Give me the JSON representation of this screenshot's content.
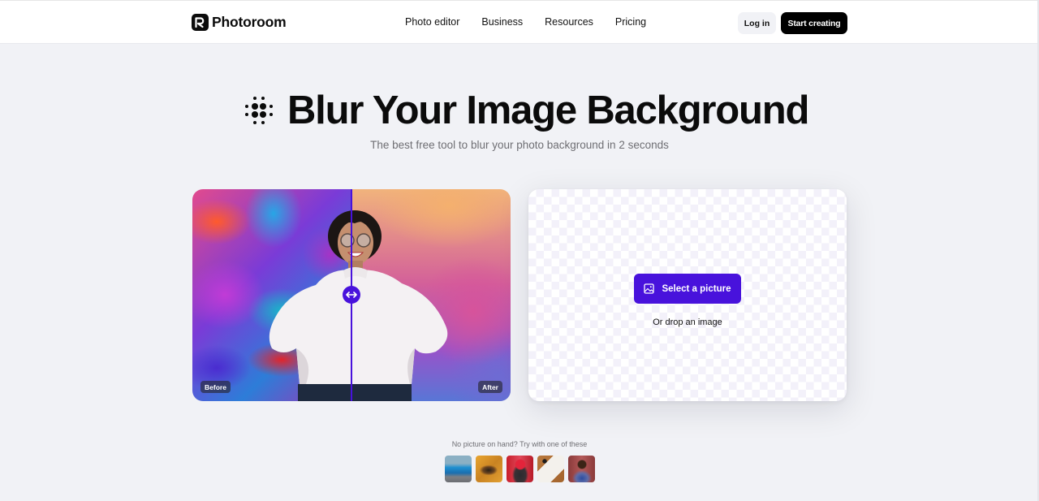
{
  "nav": {
    "brand": "Photoroom",
    "links": [
      "Photo editor",
      "Business",
      "Resources",
      "Pricing"
    ],
    "login_label": "Log in",
    "cta_label": "Start creating"
  },
  "hero": {
    "icon": "blur-dots-icon",
    "title": "Blur Your Image Background",
    "subtitle": "The best free tool to blur your photo background in 2 seconds"
  },
  "compare": {
    "before_label": "Before",
    "after_label": "After",
    "slider_position_fraction": 0.5,
    "handle_icon": "arrows-horizontal-icon"
  },
  "upload": {
    "button_label": "Select a picture",
    "button_icon": "image-icon",
    "drop_text": "Or drop an image"
  },
  "samples": {
    "label": "No picture on hand? Try with one of these",
    "items": [
      {
        "name": "blue-car"
      },
      {
        "name": "shoe"
      },
      {
        "name": "woman-red-beanie"
      },
      {
        "name": "notebook"
      },
      {
        "name": "man-portrait"
      }
    ]
  },
  "colors": {
    "accent": "#4812dc",
    "page_bg": "#f1f2f6",
    "text": "#0b0b0b",
    "muted": "#6e6e73"
  }
}
